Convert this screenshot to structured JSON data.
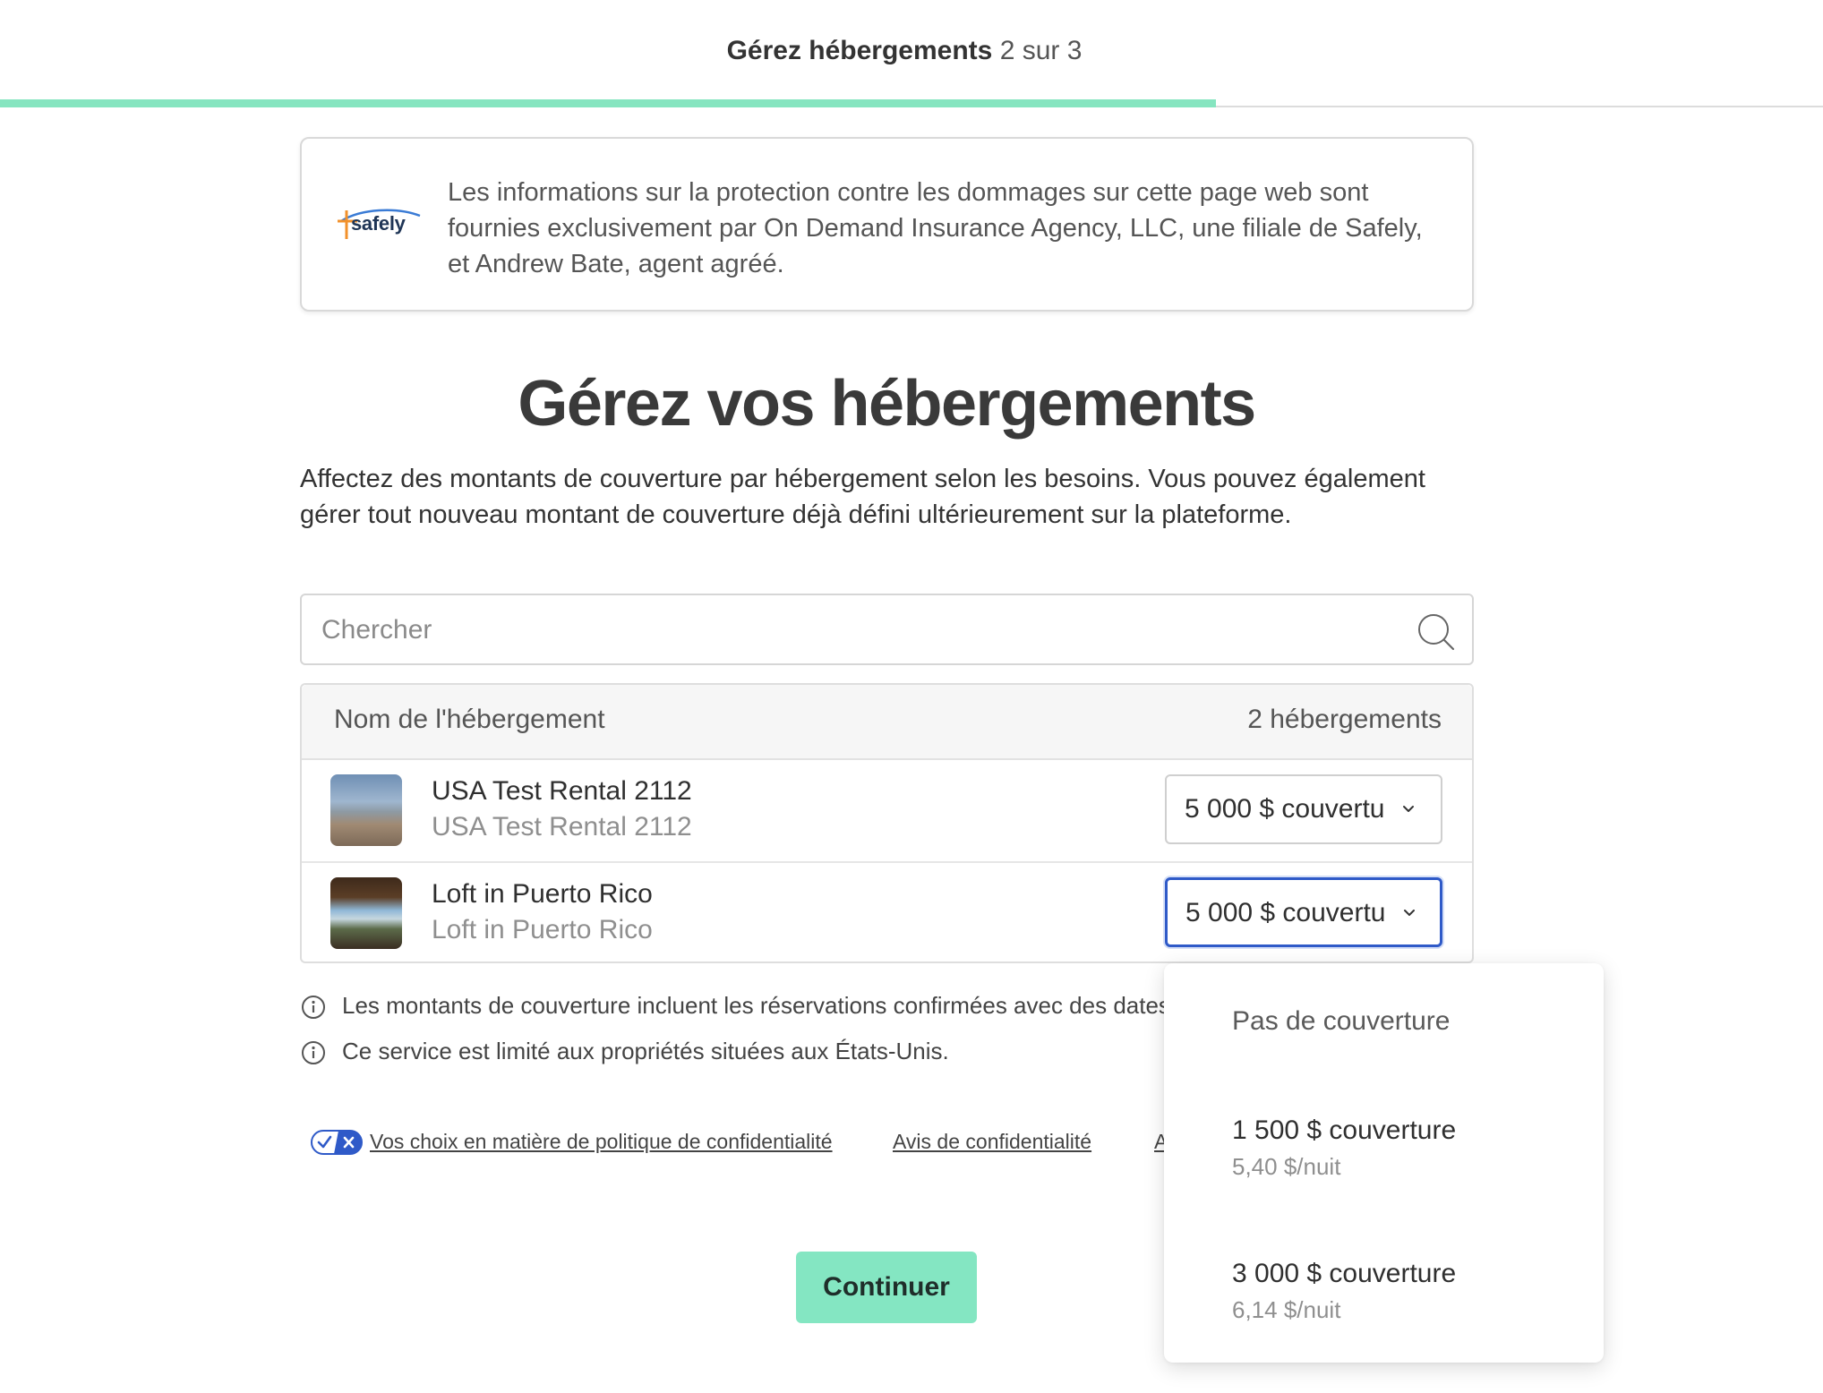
{
  "header": {
    "step_title": "Gérez hébergements",
    "step_progress": "2 sur 3",
    "progress_fraction": 0.667
  },
  "notice": {
    "logo_text": "safely",
    "text": "Les informations sur la protection contre les dommages sur cette page web sont fournies exclusivement par On Demand Insurance Agency, LLC, une filiale de Safely, et Andrew Bate, agent agréé."
  },
  "main": {
    "title": "Gérez vos hébergements",
    "description": "Affectez des montants de couverture par hébergement selon les besoins. Vous pouvez également gérer tout nouveau montant de couverture déjà défini ultérieurement sur la plateforme."
  },
  "search": {
    "placeholder": "Chercher",
    "value": ""
  },
  "table": {
    "header_name": "Nom de l'hébergement",
    "header_count": "2 hébergements",
    "rows": [
      {
        "name": "USA Test Rental 2112",
        "subtitle": "USA Test Rental 2112",
        "coverage": "5 000 $ couvertu"
      },
      {
        "name": "Loft in Puerto Rico",
        "subtitle": "Loft in Puerto Rico",
        "coverage": "5 000 $ couvertu"
      }
    ]
  },
  "info": [
    "Les montants de couverture incluent les réservations confirmées avec des dates",
    "Ce service est limité aux propriétés situées aux États-Unis."
  ],
  "footer": {
    "privacy_choices": "Vos choix en matière de politique de confidentialité",
    "privacy_notice": "Avis de confidentialité",
    "third_link_fragment": "A"
  },
  "continue_label": "Continuer",
  "dropdown": {
    "options": [
      {
        "label": "Pas de couverture",
        "price": ""
      },
      {
        "label": "1 500 $ couverture",
        "price": "5,40 $/nuit"
      },
      {
        "label": "3 000 $ couverture",
        "price": "6,14 $/nuit"
      }
    ]
  },
  "colors": {
    "accent_green": "#86e5c0",
    "button_green": "#84e6c2",
    "focus_blue": "#2f5ac8"
  },
  "icons": {
    "search": "search-icon",
    "chevron": "chevron-down-icon",
    "info": "info-icon",
    "privacy_toggle": "privacy-toggle-icon"
  }
}
